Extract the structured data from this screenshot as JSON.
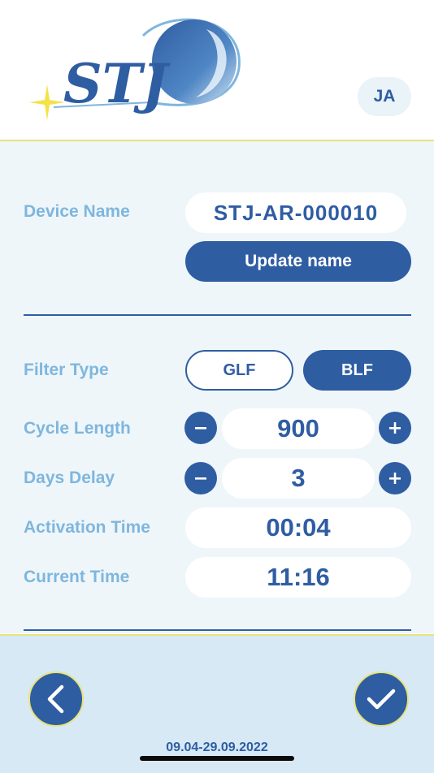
{
  "header": {
    "logo_text": "STJ",
    "language_button": "JA"
  },
  "device": {
    "label": "Device Name",
    "value": "STJ-AR-000010",
    "update_button": "Update name"
  },
  "filter": {
    "label": "Filter Type",
    "options": [
      "GLF",
      "BLF"
    ],
    "selected": "BLF"
  },
  "cycle_length": {
    "label": "Cycle Length",
    "value": "900"
  },
  "days_delay": {
    "label": "Days Delay",
    "value": "3"
  },
  "activation_time": {
    "label": "Activation Time",
    "value": "00:04"
  },
  "current_time": {
    "label": "Current Time",
    "value": "11:16"
  },
  "footer": {
    "version": "09.04-29.09.2022"
  },
  "colors": {
    "primary": "#2f5da2",
    "label": "#7fb6dd",
    "accent": "#e8e27a",
    "background": "#eef6fa",
    "footer": "#d6e9f5"
  },
  "icons": [
    "minus-icon",
    "plus-icon",
    "back-chevron-icon",
    "checkmark-icon",
    "sparkle-icon"
  ]
}
